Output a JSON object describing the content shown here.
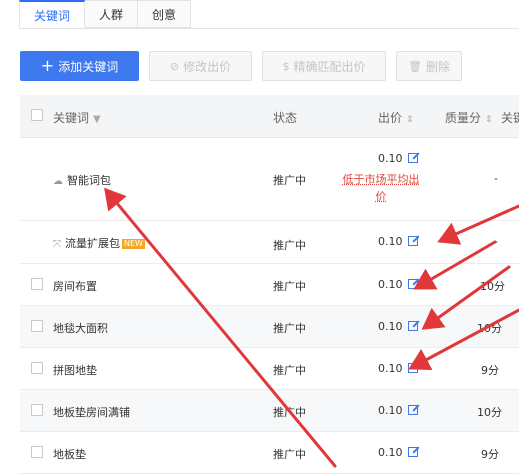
{
  "tabs": [
    {
      "label": "关键词",
      "active": true
    },
    {
      "label": "人群",
      "active": false
    },
    {
      "label": "创意",
      "active": false
    }
  ],
  "toolbar": {
    "add_label": "添加关键词",
    "edit_label": "修改出价",
    "smart_label": "精确匹配出价",
    "delete_label": "删除"
  },
  "table": {
    "headers": {
      "keyword": "关键词",
      "status": "状态",
      "price": "出价",
      "quality": "质量分",
      "extra": "关键"
    },
    "rows": [
      {
        "name": "智能词包",
        "status": "推广中",
        "price": "0.10",
        "warning": "低于市场平均出价",
        "quality": "-"
      },
      {
        "name": "流量扩展包",
        "badge": "NEW",
        "status": "推广中",
        "price": "0.10",
        "quality": "-"
      },
      {
        "name": "房间布置",
        "status": "推广中",
        "price": "0.10",
        "quality": "10分"
      },
      {
        "name": "地毯大面积",
        "status": "推广中",
        "price": "0.10",
        "quality": "10分"
      },
      {
        "name": "拼图地垫",
        "status": "推广中",
        "price": "0.10",
        "quality": "9分"
      },
      {
        "name": "地板垫房间满铺",
        "status": "推广中",
        "price": "0.10",
        "quality": "10分"
      },
      {
        "name": "地板垫",
        "status": "推广中",
        "price": "0.10",
        "quality": "9分"
      }
    ]
  },
  "colors": {
    "accent": "#3e78ee",
    "warning": "#e0463a",
    "annotation": "#e0383a"
  }
}
